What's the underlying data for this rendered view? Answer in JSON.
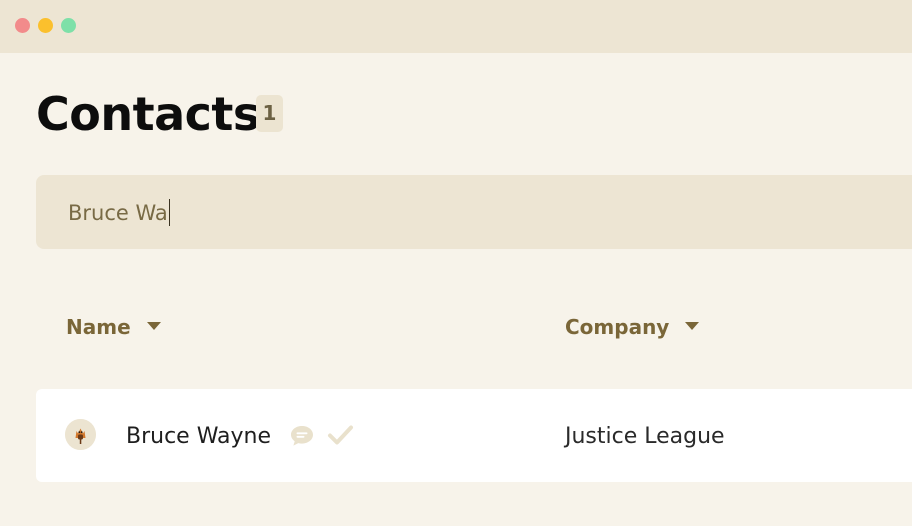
{
  "window": {
    "controls": [
      "close",
      "minimize",
      "maximize"
    ]
  },
  "header": {
    "title": "Contacts",
    "count": "1"
  },
  "search": {
    "value": "Bruce Wa"
  },
  "table": {
    "columns": [
      {
        "label": "Name",
        "sort_icon": "caret-down-icon"
      },
      {
        "label": "Company",
        "sort_icon": "caret-down-icon"
      }
    ],
    "rows": [
      {
        "avatar_icon": "bat-avatar-icon",
        "name": "Bruce Wayne",
        "status_icons": [
          "chat-bubble-icon",
          "check-icon"
        ],
        "company": "Justice League"
      }
    ]
  },
  "colors": {
    "background": "#f7f3ea",
    "titlebar": "#ede5d3",
    "accent_text": "#7a6638",
    "close": "#f28b8b",
    "minimize": "#fbc02d",
    "maximize": "#7ee0a8"
  }
}
